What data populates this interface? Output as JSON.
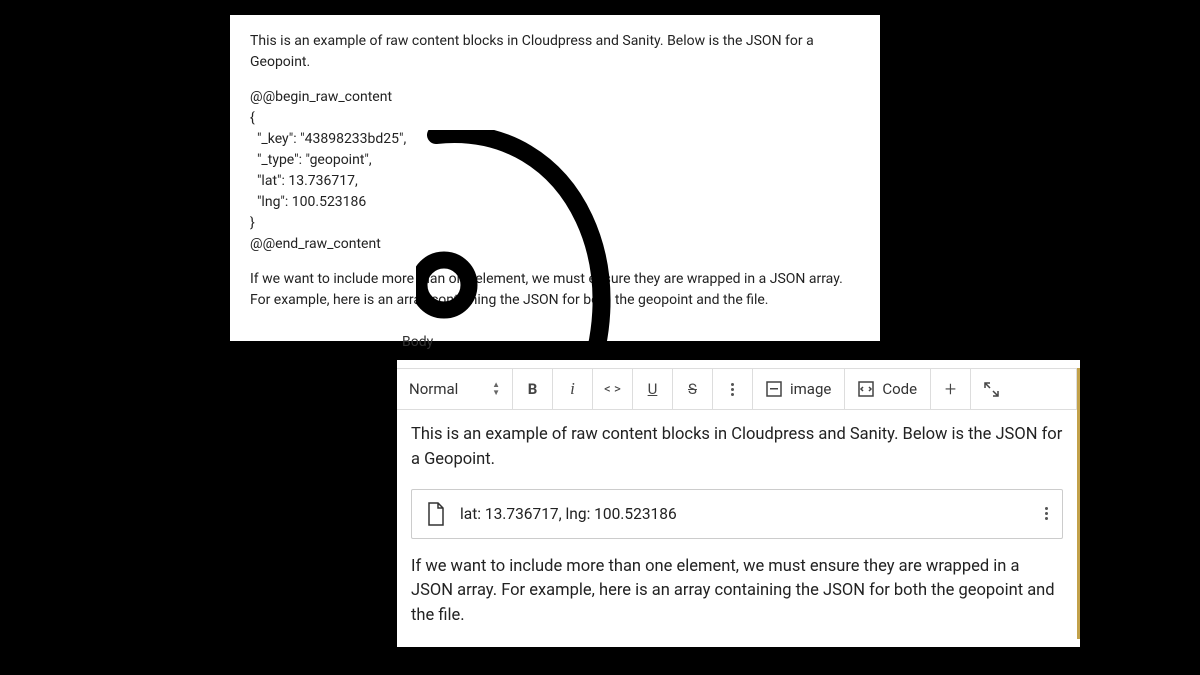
{
  "top_panel": {
    "intro": "This is an example of raw content blocks in Cloudpress and Sanity. Below is the JSON for a Geopoint.",
    "raw_begin": "@@@begin_raw_content",
    "raw_open": "{",
    "raw_key": "  \"_key\": \"43898233bd25\",",
    "raw_type": "  \"_type\": \"geopoint\",",
    "raw_lat": "  \"lat\": 13.736717,",
    "raw_lng": "  \"lng\": 100.523186",
    "raw_close": "}",
    "raw_end": "@@@end_raw_content",
    "after": "If we want to include more than one element, we must ensure they are wrapped in a JSON array. For example, here is an array containing the JSON for both the geopoint and the file."
  },
  "editor": {
    "label": "Body",
    "style_selector": "Normal",
    "toolbar": {
      "image_label": "image",
      "code_label": "Code"
    },
    "content": {
      "para1": "This is an example of raw content blocks in Cloudpress and Sanity. Below is the JSON for a Geopoint.",
      "block_text": "lat: 13.736717, lng: 100.523186",
      "para2": "If we want to include more than one element, we must ensure they are wrapped in a JSON array. For example, here is an array containing the JSON for both the geopoint and the file."
    }
  }
}
